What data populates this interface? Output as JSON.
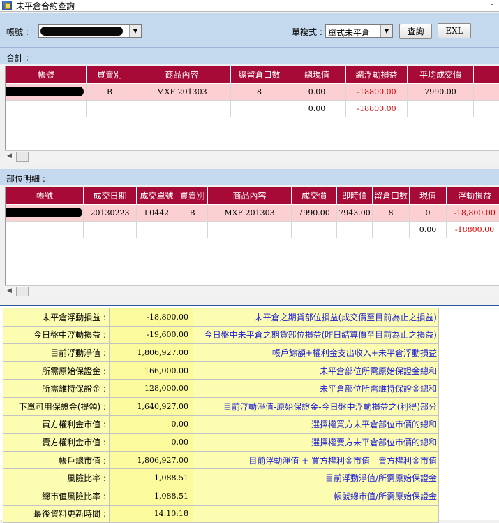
{
  "window": {
    "title": "未平倉合約查詢"
  },
  "toolbar": {
    "account_label": "帳號 :",
    "mode_label": "單複式 :",
    "mode_value": "單式未平倉",
    "query_button": "查詢",
    "excel_button": "EXL"
  },
  "totals": {
    "section_label": "合計 :",
    "headers": [
      "帳號",
      "買賣別",
      "商品內容",
      "總留倉口數",
      "總現值",
      "總浮動損益",
      "平均成交價"
    ],
    "rows": [
      {
        "side": "B",
        "product": "MXF 201303",
        "lots": "8",
        "value": "0.00",
        "pnl": "-18800.00",
        "avg_price": "7990.00"
      },
      {
        "side": "",
        "product": "",
        "lots": "",
        "value": "0.00",
        "pnl": "-18800.00",
        "avg_price": ""
      }
    ]
  },
  "detail": {
    "section_label": "部位明細 :",
    "headers": [
      "帳號",
      "成交日期",
      "成交單號",
      "買賣別",
      "商品內容",
      "成交價",
      "即時價",
      "留倉口數",
      "現值",
      "浮動損益"
    ],
    "rows": [
      {
        "date": "20130223",
        "order_no": "L0442",
        "side": "B",
        "product": "MXF 201303",
        "price": "7990.00",
        "live_price": "7943.00",
        "lots": "8",
        "value": "0",
        "pnl": "-18,800.00"
      },
      {
        "date": "",
        "order_no": "",
        "side": "",
        "product": "",
        "price": "",
        "live_price": "",
        "lots": "",
        "value": "0.00",
        "pnl": "-18800.00"
      }
    ]
  },
  "summary": [
    {
      "label": "未平倉浮動損益 :",
      "value": "-18,800.00",
      "desc": "未平倉之期貨部位損益(成交價至目前為止之損益)"
    },
    {
      "label": "今日盤中浮動損益 :",
      "value": "-19,600.00",
      "desc": "今日盤中未平倉之期貨部位損益(昨日結算價至目前為止之損益)"
    },
    {
      "label": "目前浮動淨值 :",
      "value": "1,806,927.00",
      "desc": "帳戶餘額+權利金支出收入+未平倉浮動損益"
    },
    {
      "label": "所需原始保證金 :",
      "value": "166,000.00",
      "desc": "未平倉部位所需原始保證金總和"
    },
    {
      "label": "所需維持保證金 :",
      "value": "128,000.00",
      "desc": "未平倉部位所需維持保證金總和"
    },
    {
      "label": "下單可用保證金(提領) :",
      "value": "1,640,927.00",
      "desc": "目前浮動淨值-原始保證金-今日盤中浮動損益之(利得)部分"
    },
    {
      "label": "買方權利金市值 :",
      "value": "0.00",
      "desc": "選擇權買方未平倉部位市價的總和"
    },
    {
      "label": "賣方權利金市值 :",
      "value": "0.00",
      "desc": "選擇權賣方未平倉部位市價的總和"
    },
    {
      "label": "帳戶總市值 :",
      "value": "1,806,927.00",
      "desc": "目前浮動淨值 + 買方權利金市值 - 賣方權利金市值"
    },
    {
      "label": "風險比率 :",
      "value": "1,088.51",
      "desc": "目前浮動淨值/所需原始保證金"
    },
    {
      "label": "總市值風險比率 :",
      "value": "1,088.51",
      "desc": "帳號總市值/所需原始保證金"
    },
    {
      "label": "最後資料更新時間 :",
      "value": "14:10:18",
      "desc": ""
    }
  ],
  "colors": {
    "header_bg": "#a70a36",
    "highlight_row": "#fcd0d2",
    "negative": "#e00000",
    "summary_bg": "#fdfdb2",
    "desc_text": "#1b1bd8"
  }
}
